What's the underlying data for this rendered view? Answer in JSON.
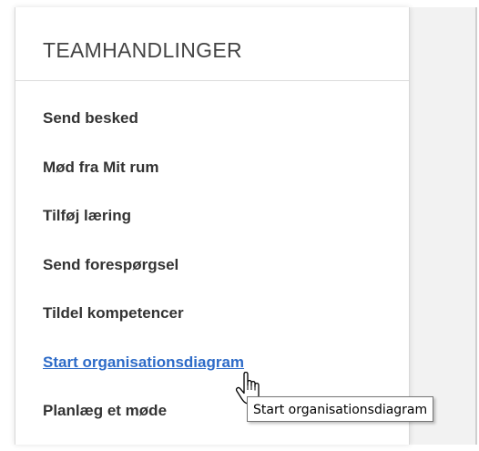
{
  "panel": {
    "title": "TEAMHANDLINGER",
    "actions": [
      {
        "label": "Send besked",
        "icon": ""
      },
      {
        "label": "Mød fra Mit rum"
      },
      {
        "label": "Tilføj læring"
      },
      {
        "label": "Send forespørgsel"
      },
      {
        "label": "Tildel kompetencer"
      },
      {
        "label": "Start organisationsdiagram",
        "state": "hovered"
      },
      {
        "label": "Planlæg et møde"
      }
    ]
  },
  "tooltip": {
    "text": "Start organisationsdiagram"
  },
  "cursor": {
    "icon": "hand-pointer-icon"
  },
  "colors": {
    "link_hover": "#2d6bc8",
    "text": "#333333",
    "title": "#444444",
    "side_background": "#f2f2f2"
  }
}
